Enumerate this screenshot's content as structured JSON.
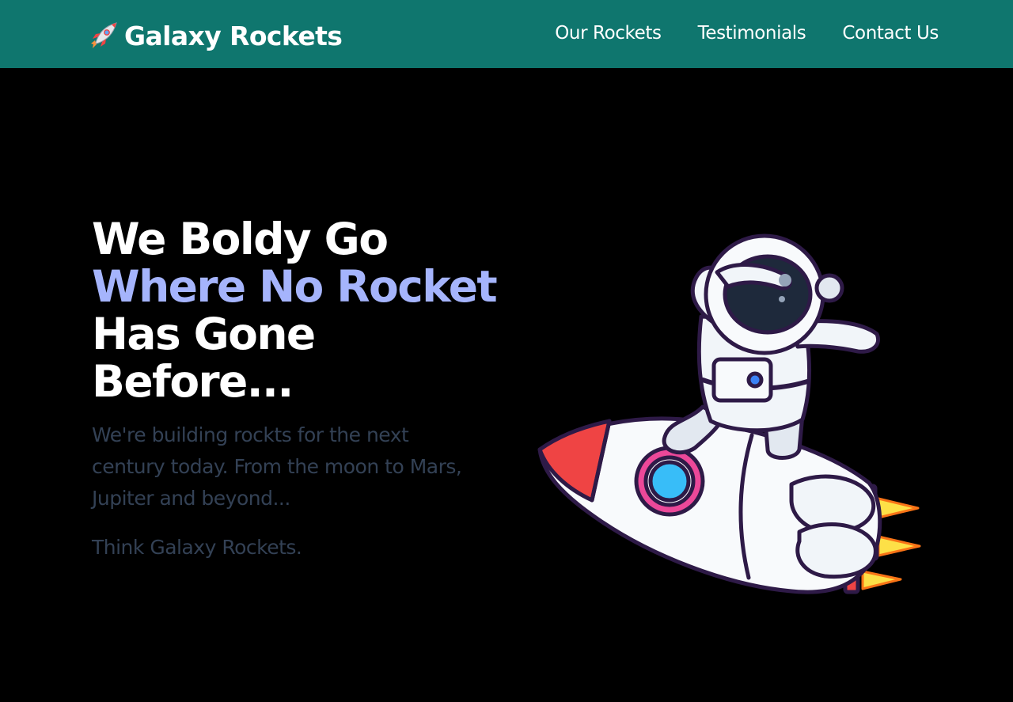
{
  "brand": {
    "name": "Galaxy Rockets",
    "icon": "rocket-icon"
  },
  "nav": {
    "links": [
      {
        "label": "Our Rockets"
      },
      {
        "label": "Testimonials"
      },
      {
        "label": "Contact Us"
      }
    ]
  },
  "hero": {
    "title_lines": [
      "We Boldy Go",
      "Where No Rocket",
      "Has Gone",
      "Before..."
    ],
    "description": "We're building rockts for the next century today. From the moon to Mars, Jupiter and beyond...",
    "tagline": "Think Galaxy Rockets.",
    "illustration": "astronaut-on-rocket-illustration"
  },
  "colors": {
    "navbar_bg": "#0f766e",
    "hero_bg": "#000000",
    "accent_text": "#a5b4fc",
    "muted_text": "#334155"
  }
}
